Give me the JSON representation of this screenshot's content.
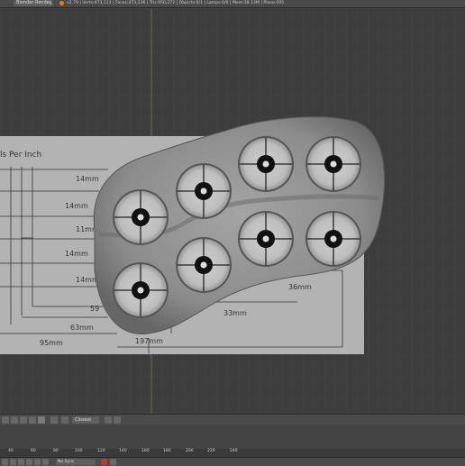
{
  "topbar": {
    "render_engine": "Blender Render",
    "info": "v2.79 | Verts:473,112 | Faces:473,136 | Tris:950,272 | Objects:0/1 | Lamps:0/0 | Mem:38.13M | Plane.005"
  },
  "viewport": {
    "reference_title": "ls Per Inch",
    "dimensions": [
      "14mm",
      "14mm",
      "11mm",
      "14mm",
      "14mm",
      "59",
      "63mm",
      "95mm",
      "197mm",
      "33mm",
      "36mm"
    ]
  },
  "header": {
    "frame_dropdown": "Closest"
  },
  "timeline": {
    "tick_labels": [
      "40",
      "60",
      "80",
      "100",
      "120",
      "140",
      "160",
      "180",
      "200",
      "220",
      "240"
    ],
    "sync": "No Sync"
  },
  "colors": {
    "accent": "#e87d0d",
    "bg": "#3d3d3d",
    "paper": "#b0b0b0",
    "plate": "#8a8a8a"
  }
}
